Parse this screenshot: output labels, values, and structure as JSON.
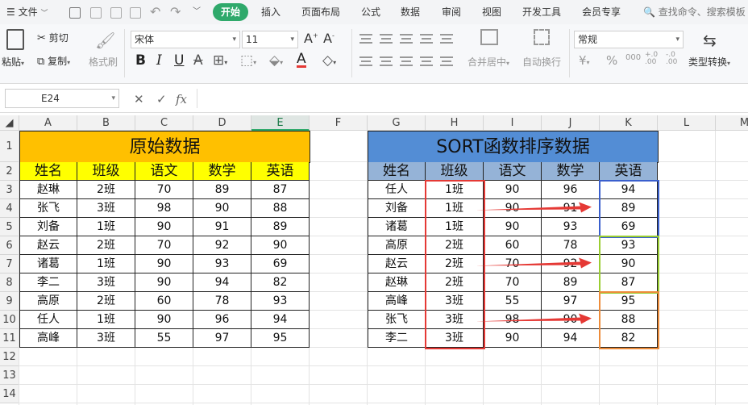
{
  "menubar": {
    "file_label": "文件",
    "tabs": [
      "开始",
      "插入",
      "页面布局",
      "公式",
      "数据",
      "审阅",
      "视图",
      "开发工具",
      "会员专享"
    ],
    "search_placeholder": "查找命令、搜索模板"
  },
  "ribbon": {
    "paste": "粘贴",
    "cut": "剪切",
    "copy": "复制",
    "format_painter": "格式刷",
    "font_name": "宋体",
    "font_size": "11",
    "merge_center": "合并居中",
    "wrap_text": "自动换行",
    "number_format": "常规",
    "type_convert": "类型转换"
  },
  "formula_bar": {
    "cell_ref": "E24",
    "fx": "fx",
    "formula": ""
  },
  "sheet": {
    "columns": [
      "A",
      "B",
      "C",
      "D",
      "E",
      "F",
      "G",
      "H",
      "I",
      "J",
      "K",
      "L",
      "M"
    ],
    "rows": [
      "1",
      "2",
      "3",
      "4",
      "5",
      "6",
      "7",
      "8",
      "9",
      "10",
      "11",
      "12",
      "13",
      "14"
    ],
    "selected_column": "E",
    "left_table": {
      "title": "原始数据",
      "headers": [
        "姓名",
        "班级",
        "语文",
        "数学",
        "英语"
      ],
      "rows": [
        [
          "赵琳",
          "2班",
          "70",
          "89",
          "87"
        ],
        [
          "张飞",
          "3班",
          "98",
          "90",
          "88"
        ],
        [
          "刘备",
          "1班",
          "90",
          "91",
          "89"
        ],
        [
          "赵云",
          "2班",
          "70",
          "92",
          "90"
        ],
        [
          "诸葛",
          "1班",
          "90",
          "93",
          "69"
        ],
        [
          "李二",
          "3班",
          "90",
          "94",
          "82"
        ],
        [
          "高原",
          "2班",
          "60",
          "78",
          "93"
        ],
        [
          "任人",
          "1班",
          "90",
          "96",
          "94"
        ],
        [
          "高峰",
          "3班",
          "55",
          "97",
          "95"
        ]
      ]
    },
    "right_table": {
      "title": "SORT函数排序数据",
      "headers": [
        "姓名",
        "班级",
        "语文",
        "数学",
        "英语"
      ],
      "rows": [
        [
          "任人",
          "1班",
          "90",
          "96",
          "94"
        ],
        [
          "刘备",
          "1班",
          "90",
          "91",
          "89"
        ],
        [
          "诸葛",
          "1班",
          "90",
          "93",
          "69"
        ],
        [
          "高原",
          "2班",
          "60",
          "78",
          "93"
        ],
        [
          "赵云",
          "2班",
          "70",
          "92",
          "90"
        ],
        [
          "赵琳",
          "2班",
          "70",
          "89",
          "87"
        ],
        [
          "高峰",
          "3班",
          "55",
          "97",
          "95"
        ],
        [
          "张飞",
          "3班",
          "98",
          "90",
          "88"
        ],
        [
          "李二",
          "3班",
          "90",
          "94",
          "82"
        ]
      ]
    },
    "colors": {
      "left_title_bg": "#ffc000",
      "left_header_bg": "#ffff00",
      "right_title_bg": "#538dd5",
      "right_header_bg": "#95b3d7",
      "class_box": "#e53935",
      "group1_box": "#3a5fcd",
      "group2_box": "#9acd32",
      "group3_box": "#ed8c3a",
      "arrow": "#e53935",
      "accent": "#2fa96b"
    }
  }
}
